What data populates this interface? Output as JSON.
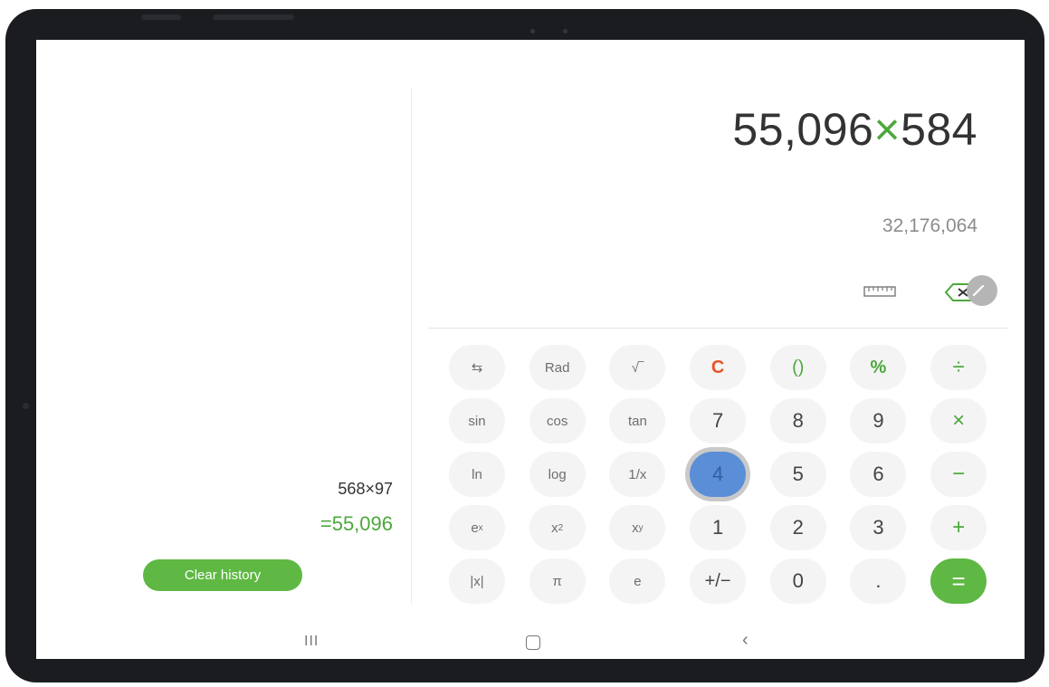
{
  "history": {
    "entries": [
      {
        "expression": "568×97",
        "result": "=55,096"
      }
    ],
    "clear_label": "Clear history"
  },
  "display": {
    "expression_left": "55,096",
    "expression_operator": "×",
    "expression_right": "584",
    "preview_result": "32,176,064"
  },
  "toolbar": {
    "icons": [
      "ruler-icon",
      "backspace-icon"
    ]
  },
  "keypad": {
    "rows": [
      [
        "⇆",
        "Rad",
        "√‾",
        "C",
        "()",
        "%",
        "÷"
      ],
      [
        "sin",
        "cos",
        "tan",
        "7",
        "8",
        "9",
        "×"
      ],
      [
        "ln",
        "log",
        "1/x",
        "4",
        "5",
        "6",
        "−"
      ],
      [
        "e^x",
        "x^2",
        "x^y",
        "1",
        "2",
        "3",
        "+"
      ],
      [
        "|x|",
        "π",
        "e",
        "+/−",
        "0",
        ".",
        "="
      ]
    ],
    "sci": {
      "toggle": "⇆",
      "rad": "Rad",
      "sqrt": "√‾",
      "sin": "sin",
      "cos": "cos",
      "tan": "tan",
      "ln": "ln",
      "log": "log",
      "inv": "1/x",
      "exp_base": "e",
      "exp_sup": "x",
      "sq_base": "x",
      "sq_sup": "2",
      "pow_base": "x",
      "pow_sup": "y",
      "abs": "|x|",
      "pi": "π",
      "e": "e"
    },
    "ops": {
      "clear": "C",
      "paren": "()",
      "percent": "%",
      "divide": "÷",
      "multiply": "×",
      "minus": "−",
      "plus": "+",
      "equals": "=",
      "negate": "+/−",
      "dot": "."
    },
    "digits": {
      "d0": "0",
      "d1": "1",
      "d2": "2",
      "d3": "3",
      "d4": "4",
      "d5": "5",
      "d6": "6",
      "d7": "7",
      "d8": "8",
      "d9": "9"
    },
    "pressed_key": "4"
  },
  "colors": {
    "accent_green": "#5fb844",
    "operator_green": "#4ca83c",
    "clear_red": "#e8542a",
    "pressed_blue": "#5a8ed6"
  },
  "navbar": {
    "recent_glyph": "III",
    "back_glyph": "‹"
  }
}
